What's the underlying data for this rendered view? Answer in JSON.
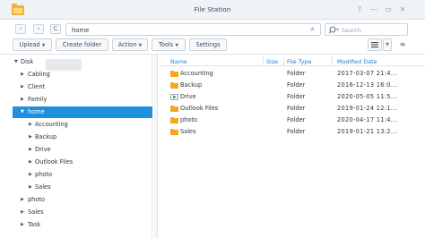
{
  "window": {
    "title": "File Station",
    "controls": [
      "?",
      "—",
      "▭",
      "✕"
    ]
  },
  "nav": {
    "back": "‹",
    "forward": "›",
    "refresh": "C"
  },
  "path": {
    "value": "home"
  },
  "search": {
    "placeholder": "Search"
  },
  "toolbar": {
    "upload": "Upload",
    "create_folder": "Create folder",
    "action": "Action",
    "tools": "Tools",
    "settings": "Settings"
  },
  "sidebar": {
    "root": "Disk",
    "items": [
      {
        "label": "Cabling",
        "expanded": false,
        "selected": false
      },
      {
        "label": "Client",
        "expanded": false,
        "selected": false
      },
      {
        "label": "Family",
        "expanded": false,
        "selected": false
      },
      {
        "label": "home",
        "expanded": true,
        "selected": true
      }
    ],
    "home_children": [
      "Accounting",
      "Backup",
      "Drive",
      "Outlook Files",
      "photo",
      "Sales"
    ],
    "after": [
      "photo",
      "Sales",
      "Task"
    ]
  },
  "filelist": {
    "columns": {
      "name": "Name",
      "size": "Size",
      "type": "File Type",
      "modified": "Modified Date"
    },
    "rows": [
      {
        "name": "Accounting",
        "type": "Folder",
        "modified": "2017-03-07 21:4...",
        "icon": "folder-icon"
      },
      {
        "name": "Backup",
        "type": "Folder",
        "modified": "2016-12-13 16:0...",
        "icon": "folder-icon"
      },
      {
        "name": "Drive",
        "type": "Folder",
        "modified": "2020-05-05 11:5...",
        "icon": "drive-folder-icon"
      },
      {
        "name": "Outlook Files",
        "type": "Folder",
        "modified": "2019-01-24 12:1...",
        "icon": "folder-icon"
      },
      {
        "name": "photo",
        "type": "Folder",
        "modified": "2020-04-17 11:4...",
        "icon": "folder-icon"
      },
      {
        "name": "Sales",
        "type": "Folder",
        "modified": "2019-01-21 13:2...",
        "icon": "folder-icon"
      }
    ]
  },
  "colors": {
    "accent": "#1f8fe0",
    "folder": "#f5a623",
    "header_text": "#1f7fcf",
    "titlebar": "#eef3f8"
  }
}
